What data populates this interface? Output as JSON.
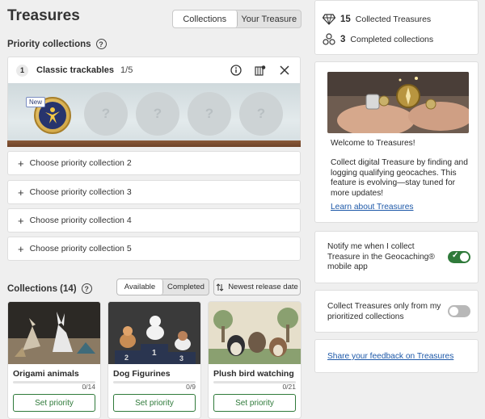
{
  "page": {
    "title": "Treasures",
    "view_tabs": [
      "Collections",
      "Your Treasure"
    ],
    "active_view_tab": 0
  },
  "priority": {
    "heading": "Priority collections",
    "help_icon": "question-circle-icon",
    "slot1": {
      "number": "1",
      "name": "Classic trackables",
      "count": "1/5",
      "new_label": "New",
      "empty_glyph": "?"
    },
    "choose_items": [
      "Choose priority collection 2",
      "Choose priority collection 3",
      "Choose priority collection 4",
      "Choose priority collection 5"
    ]
  },
  "collections": {
    "heading": "Collections (14)",
    "filter_tabs": [
      "Available",
      "Completed"
    ],
    "sort_label": "Newest release date",
    "cards": [
      {
        "name": "Origami animals",
        "progress": "0/14",
        "found": 0,
        "total": 14,
        "button": "Set priority"
      },
      {
        "name": "Dog Figurines",
        "progress": "0/9",
        "found": 0,
        "total": 9,
        "button": "Set priority"
      },
      {
        "name": "Plush bird watching",
        "progress": "0/21",
        "found": 0,
        "total": 21,
        "button": "Set priority"
      }
    ],
    "podium_numbers": [
      "2",
      "1",
      "3"
    ]
  },
  "stats": {
    "collected_count": "15",
    "collected_label": "Collected Treasures",
    "completed_count": "3",
    "completed_label": "Completed collections"
  },
  "welcome": {
    "title": "Welcome to Treasures!",
    "body": "Collect digital Treasure by finding and logging qualifying geocaches. This feature is evolving—stay tuned for more updates!",
    "link": "Learn about Treasures"
  },
  "settings": {
    "notify_label": "Notify me when I collect Treasure in the Geocaching® mobile app",
    "notify_on": true,
    "priority_only_label": "Collect Treasures only from my prioritized collections",
    "priority_only_on": false
  },
  "feedback_link": "Share your feedback on Treasures",
  "colors": {
    "accent_green": "#2f7a3a",
    "link_blue": "#1d58a8"
  }
}
